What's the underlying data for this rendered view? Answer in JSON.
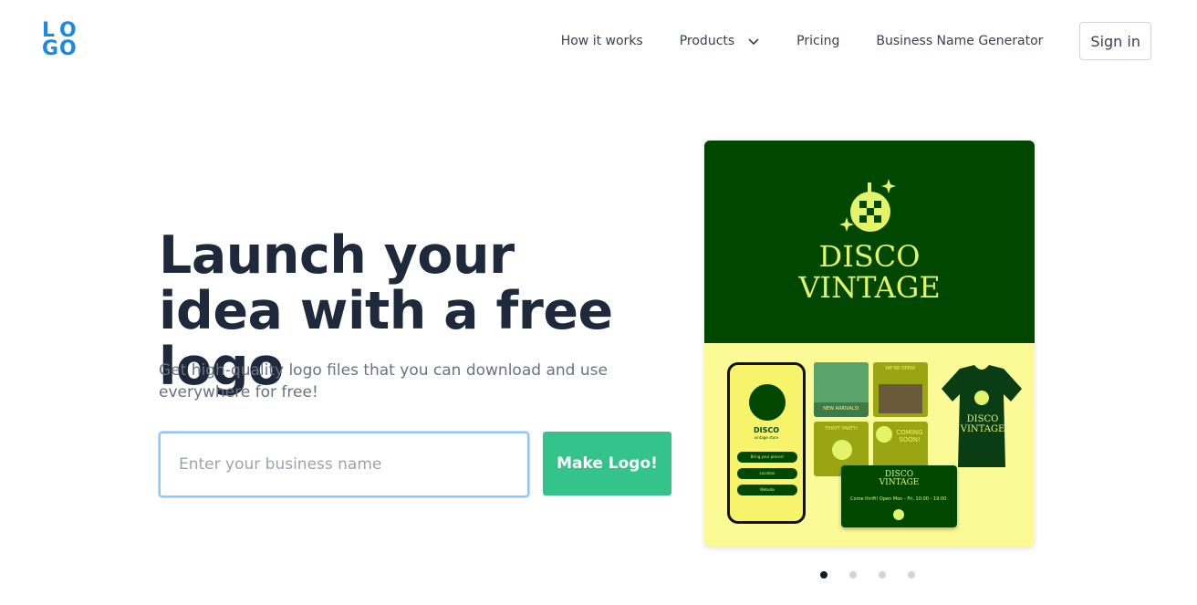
{
  "header": {
    "logo_letters": [
      "L",
      "O",
      "G",
      "O"
    ],
    "nav": [
      {
        "label": "How it works"
      },
      {
        "label": "Products"
      },
      {
        "label": "Pricing"
      },
      {
        "label": "Business Name Generator"
      }
    ],
    "signin_label": "Sign in"
  },
  "hero": {
    "headline": "Launch your idea with a free logo",
    "subtitle": "Get high-quality logo files that you can download and use everywhere for free!",
    "input_placeholder": "Enter your business name",
    "cta_label": "Make Logo!"
  },
  "showcase": {
    "brand_line1": "DISCO",
    "brand_line2": "VINTAGE",
    "phone_title": "DISCO",
    "phone_subtitle": "vintage store",
    "phone_buttons": [
      "Bring your pieces!",
      "Location",
      "Website"
    ],
    "tiles": [
      "NEW ARRIVALS!",
      "WE'RE OPEN!",
      "THRIFT PARTY!",
      "COMING SOON!"
    ],
    "tshirt_text": "DISCO VINTAGE",
    "card_line1": "DISCO",
    "card_line2": "VINTAGE",
    "card_hours": "Come thrift! Open Mon - Fri, 10:00 - 19:00.",
    "colors": {
      "dark_green": "#004700",
      "light_yellow": "#fafa96",
      "accent_yellow": "#e3f46a"
    }
  },
  "carousel": {
    "total": 4,
    "active_index": 1
  },
  "colors": {
    "brand_blue": "#1e88e5",
    "cta_green": "#34c48b",
    "heading": "#1e293b"
  }
}
